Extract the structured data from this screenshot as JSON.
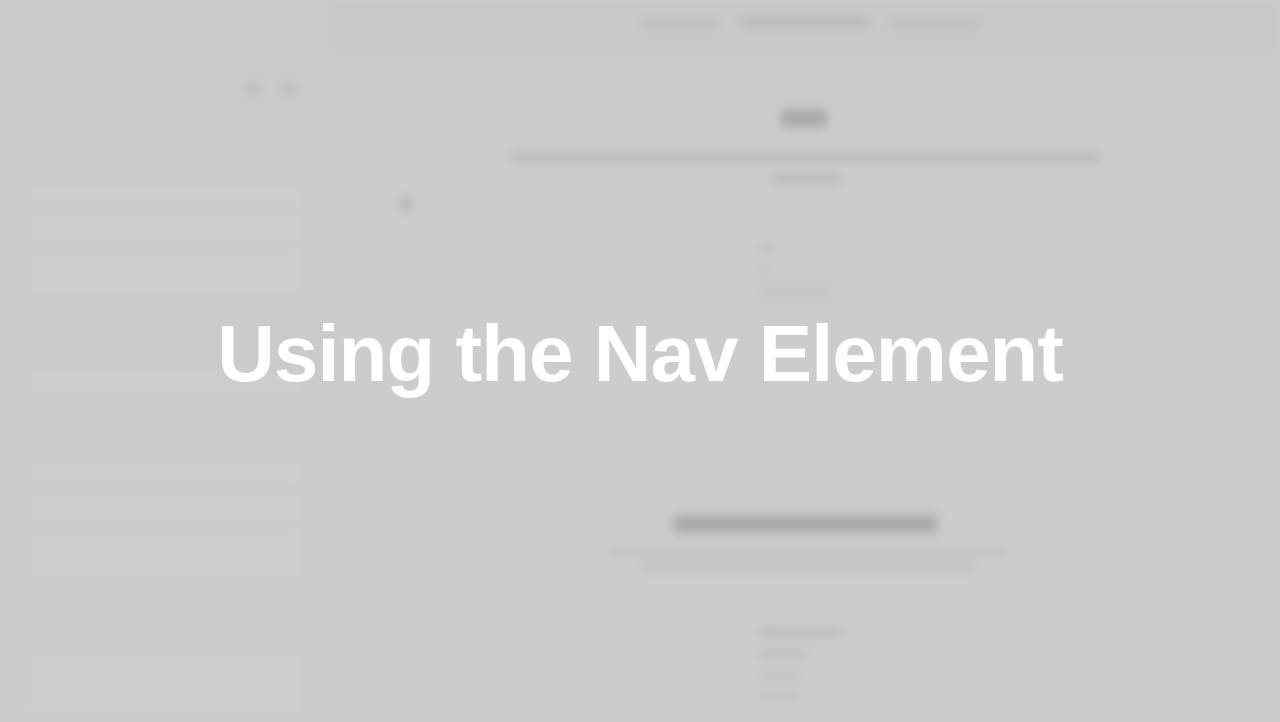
{
  "overlay": {
    "title": "Using the Nav Element"
  },
  "colors": {
    "background": "#cccccc",
    "overlay_text": "#ffffff"
  }
}
